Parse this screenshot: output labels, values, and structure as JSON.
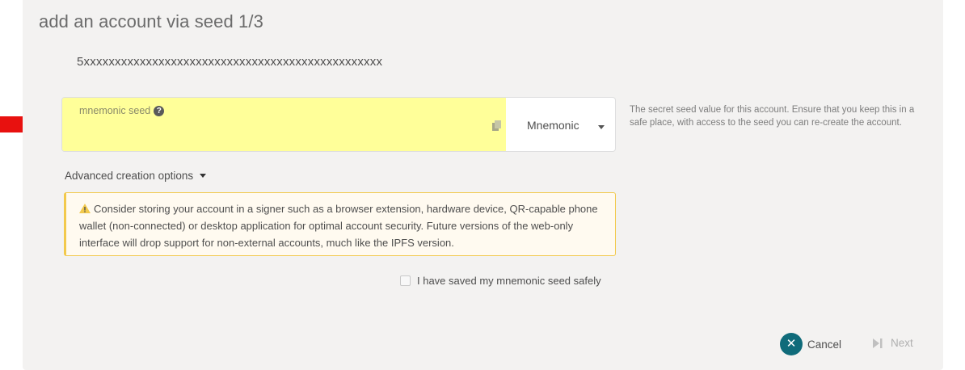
{
  "modal": {
    "title": "add an account via seed 1/3",
    "address": "5xxxxxxxxxxxxxxxxxxxxxxxxxxxxxxxxxxxxxxxxxxxxxxxx"
  },
  "seed": {
    "label": "mnemonic seed",
    "value": "",
    "type_selected": "Mnemonic",
    "help_text": "The secret seed value for this account. Ensure that you keep this in a safe place, with access to the seed you can re-create the account."
  },
  "advanced": {
    "label": "Advanced creation options"
  },
  "warning": {
    "text": "Consider storing your account in a signer such as a browser extension, hardware device, QR-capable phone wallet (non-connected) or desktop application for optimal account security. Future versions of the web-only interface will drop support for non-external accounts, much like the IPFS version."
  },
  "confirm": {
    "label": "I have saved my mnemonic seed safely"
  },
  "actions": {
    "cancel_label": "Cancel",
    "next_label": "Next"
  },
  "icons": {
    "help": "question-circle-icon",
    "copy": "copy-icon",
    "warning": "warning-triangle-icon",
    "cancel": "close-circle-icon",
    "next": "step-forward-icon",
    "arrow": "red-arrow-pointer"
  },
  "colors": {
    "seed_highlight": "#ffff99",
    "warning_border": "#f2c94c",
    "cancel_button": "#0f6b7a",
    "arrow": "#e8110f"
  }
}
